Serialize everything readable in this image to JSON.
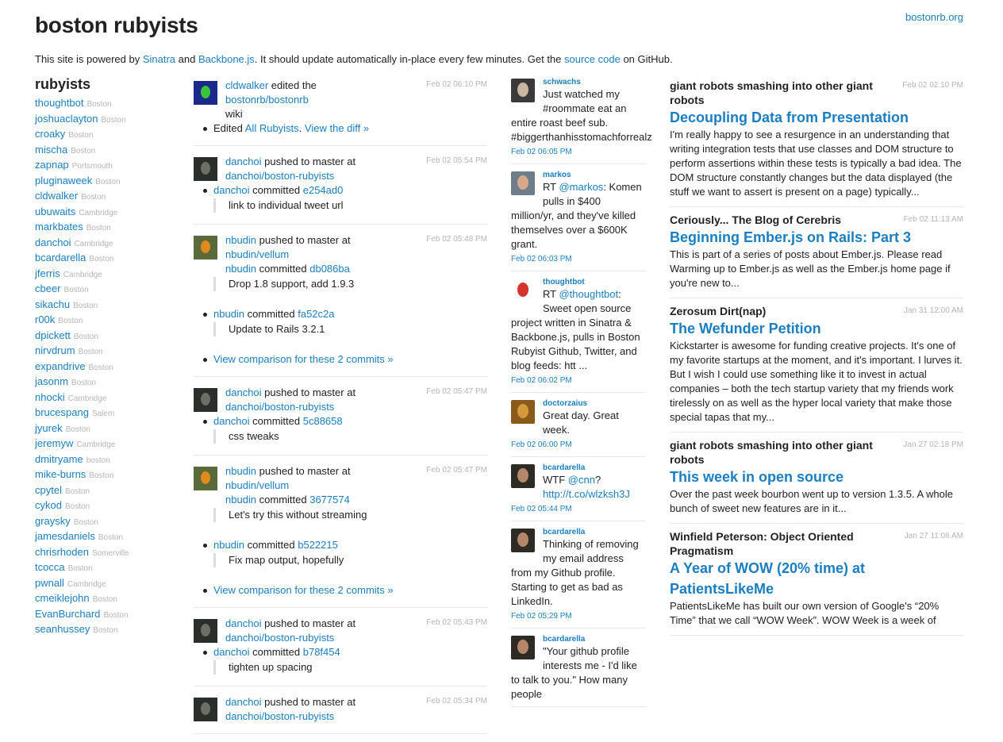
{
  "site": {
    "title": "boston rubyists",
    "link": "bostonrb.org",
    "intro": {
      "t1": "This site is powered by ",
      "l1": "Sinatra",
      "t2": " and ",
      "l2": "Backbone.js",
      "t3": ". It should update automatically in-place every few minutes. Get the ",
      "l3": "source code",
      "t4": " on GitHub."
    }
  },
  "rubyists": {
    "heading": "rubyists",
    "items": [
      {
        "name": "thoughtbot",
        "loc": "Boston"
      },
      {
        "name": "joshuaclayton",
        "loc": "Boston"
      },
      {
        "name": "croaky",
        "loc": "Boston"
      },
      {
        "name": "mischa",
        "loc": "Boston"
      },
      {
        "name": "zapnap",
        "loc": "Portsmouth"
      },
      {
        "name": "pluginaweek",
        "loc": "Boston"
      },
      {
        "name": "cldwalker",
        "loc": "Boston"
      },
      {
        "name": "ubuwaits",
        "loc": "Cambridge"
      },
      {
        "name": "markbates",
        "loc": "Boston"
      },
      {
        "name": "danchoi",
        "loc": "Cambridge"
      },
      {
        "name": "bcardarella",
        "loc": "Boston"
      },
      {
        "name": "jferris",
        "loc": "Cambridge"
      },
      {
        "name": "cbeer",
        "loc": "Boston"
      },
      {
        "name": "sikachu",
        "loc": "Boston"
      },
      {
        "name": "r00k",
        "loc": "Boston"
      },
      {
        "name": "dpickett",
        "loc": "Boston"
      },
      {
        "name": "nirvdrum",
        "loc": "Boston"
      },
      {
        "name": "expandrive",
        "loc": "Boston"
      },
      {
        "name": "jasonm",
        "loc": "Boston"
      },
      {
        "name": "nhocki",
        "loc": "Cambridge"
      },
      {
        "name": "brucespang",
        "loc": "Salem"
      },
      {
        "name": "jyurek",
        "loc": "Boston"
      },
      {
        "name": "jeremyw",
        "loc": "Cambridge"
      },
      {
        "name": "dmitryame",
        "loc": "boston"
      },
      {
        "name": "mike-burns",
        "loc": "Boston"
      },
      {
        "name": "cpytel",
        "loc": "Boston"
      },
      {
        "name": "cykod",
        "loc": "Boston"
      },
      {
        "name": "graysky",
        "loc": "Boston"
      },
      {
        "name": "jamesdaniels",
        "loc": "Boston"
      },
      {
        "name": "chrisrhoden",
        "loc": "Somerville"
      },
      {
        "name": "tcocca",
        "loc": "Boston"
      },
      {
        "name": "pwnall",
        "loc": "Cambridge"
      },
      {
        "name": "cmeiklejohn",
        "loc": "Boston"
      },
      {
        "name": "EvanBurchard",
        "loc": "Boston"
      },
      {
        "name": "seanhussey",
        "loc": "Boston"
      }
    ]
  },
  "github": {
    "events": [
      {
        "user": "cldwalker",
        "verb": " edited the ",
        "target": "bostonrb/bostonrb",
        "suffix": "wiki",
        "time": "Feb 02 06:10 PM",
        "avatar_bg": "#1b2a8a",
        "avatar_face": "#39c43a",
        "edit": {
          "pre": "Edited ",
          "page": "All Rubyists",
          "mid": ". ",
          "diff": "View the diff »"
        }
      },
      {
        "user": "danchoi",
        "verb": " pushed to master at",
        "target": "danchoi/boston-rubyists",
        "time": "Feb 02 05:54 PM",
        "avatar_bg": "#2a2f2c",
        "avatar_face": "#6b6f66",
        "commits": [
          {
            "user": "danchoi",
            "sha": "e254ad0",
            "msg": "link to individual tweet url"
          }
        ]
      },
      {
        "user": "nbudin",
        "verb": " pushed to master at ",
        "target": "nbudin/vellum",
        "time": "Feb 02 05:48 PM",
        "avatar_bg": "#5a6a3a",
        "avatar_face": "#e08a1e",
        "sub_user": "nbudin",
        "sub_sha": "db086ba",
        "sub_msg": "Drop 1.8 support, add 1.9.3",
        "commits": [
          {
            "user": "nbudin",
            "sha": "fa52c2a",
            "msg": "Update to Rails 3.2.1"
          }
        ],
        "compare": "View comparison for these 2 commits »"
      },
      {
        "user": "danchoi",
        "verb": " pushed to master at",
        "target": "danchoi/boston-rubyists",
        "time": "Feb 02 05:47 PM",
        "avatar_bg": "#2a2f2c",
        "avatar_face": "#6b6f66",
        "commits": [
          {
            "user": "danchoi",
            "sha": "5c88658",
            "msg": "css tweaks"
          }
        ]
      },
      {
        "user": "nbudin",
        "verb": " pushed to master at ",
        "target": "nbudin/vellum",
        "time": "Feb 02 05:47 PM",
        "avatar_bg": "#5a6a3a",
        "avatar_face": "#e08a1e",
        "sub_user": "nbudin",
        "sub_sha": "3677574",
        "sub_msg": "Let's try this without streaming",
        "commits": [
          {
            "user": "nbudin",
            "sha": "b522215",
            "msg": "Fix map output, hopefully"
          }
        ],
        "compare": "View comparison for these 2 commits »"
      },
      {
        "user": "danchoi",
        "verb": " pushed to master at",
        "target": "danchoi/boston-rubyists",
        "time": "Feb 02 05:43 PM",
        "avatar_bg": "#2a2f2c",
        "avatar_face": "#6b6f66",
        "commits": [
          {
            "user": "danchoi",
            "sha": "b78f454",
            "msg": "tighten up spacing"
          }
        ]
      },
      {
        "user": "danchoi",
        "verb": " pushed to master at",
        "target": "danchoi/boston-rubyists",
        "time": "Feb 02 05:34 PM",
        "avatar_bg": "#2a2f2c",
        "avatar_face": "#6b6f66",
        "commits": []
      }
    ]
  },
  "tweets": [
    {
      "user": "schwachs",
      "avatar_bg": "#3a3a3a",
      "avatar_face": "#c9b7a4",
      "parts": [
        {
          "t": "Just watched my #roommate eat an entire roast beef sub. #biggerthanhisstomachforrealz"
        }
      ],
      "time": "Feb 02 06:05 PM"
    },
    {
      "user": "markos",
      "avatar_bg": "#6d7d8a",
      "avatar_face": "#d6a98a",
      "parts": [
        {
          "t": "RT "
        },
        {
          "l": "@markos"
        },
        {
          "t": ": Komen pulls in $400 million/yr, and they've killed themselves over a $600K grant."
        }
      ],
      "time": "Feb 02 06:03 PM"
    },
    {
      "user": "thoughtbot",
      "avatar_bg": "#ffffff",
      "avatar_face": "#d6332b",
      "parts": [
        {
          "t": "RT "
        },
        {
          "l": "@thoughtbot"
        },
        {
          "t": ": Sweet open source project written in Sinatra & Backbone.js, pulls in Boston Rubyist Github, Twitter, and blog feeds: htt ..."
        }
      ],
      "time": "Feb 02 06:02 PM"
    },
    {
      "user": "doctorzaius",
      "avatar_bg": "#8a5a1c",
      "avatar_face": "#d39a3c",
      "parts": [
        {
          "t": "Great day. Great week."
        }
      ],
      "time": "Feb 02 06:00 PM"
    },
    {
      "user": "bcardarella",
      "avatar_bg": "#2e2a26",
      "avatar_face": "#b5876a",
      "parts": [
        {
          "t": "WTF "
        },
        {
          "l": "@cnn"
        },
        {
          "t": "? "
        },
        {
          "l": "http://t.co/wlzksh3J"
        }
      ],
      "time": "Feb 02 05:44 PM"
    },
    {
      "user": "bcardarella",
      "avatar_bg": "#2e2a26",
      "avatar_face": "#b5876a",
      "parts": [
        {
          "t": "Thinking of removing my email address from my Github profile. Starting to get as bad as LinkedIn."
        }
      ],
      "time": "Feb 02 05:29 PM"
    },
    {
      "user": "bcardarella",
      "avatar_bg": "#2e2a26",
      "avatar_face": "#b5876a",
      "parts": [
        {
          "t": "\"Your github profile interests me - I'd like to talk to you.\" How many people"
        }
      ],
      "time": ""
    }
  ],
  "posts": [
    {
      "blog": "giant robots smashing into other giant robots",
      "date": "Feb 02 02:10 PM",
      "title": "Decoupling Data from Presentation",
      "excerpt": "I'm really happy to see a resurgence in an understanding that writing integration tests that use classes and DOM structure to perform assertions within these tests is typically a bad idea. The DOM structure constantly changes but the data displayed (the stuff we want to assert is present on a page) typically..."
    },
    {
      "blog": "Ceriously... The Blog of Cerebris",
      "date": "Feb 02 11:13 AM",
      "title": "Beginning Ember.js on Rails: Part 3",
      "excerpt": "This is part of a series of posts about Ember.js. Please read Warming up to Ember.js as well as the Ember.js home page if you're new to..."
    },
    {
      "blog": "Zerosum Dirt(nap)",
      "date": "Jan 31 12:00 AM",
      "title": "The Wefunder Petition",
      "excerpt": "Kickstarter is awesome for funding creative projects. It's one of my favorite startups at the moment, and it's important. I lurves it. But I wish I could use something like it to invest in actual companies – both the tech startup variety that my friends work tirelessly on as well as the hyper local variety that make those special tapas that my..."
    },
    {
      "blog": "giant robots smashing into other giant robots",
      "date": "Jan 27 02:18 PM",
      "title": "This week in open source",
      "excerpt": "Over the past week bourbon went up to version 1.3.5. A whole bunch of sweet new features are in it..."
    },
    {
      "blog": "Winfield Peterson: Object Oriented Pragmatism",
      "date": "Jan 27 11:06 AM",
      "title": "A Year of WOW (20% time) at PatientsLikeMe",
      "excerpt": "PatientsLikeMe has built our own version of Google's “20% Time” that we call “WOW Week”. WOW Week is a week of"
    }
  ]
}
